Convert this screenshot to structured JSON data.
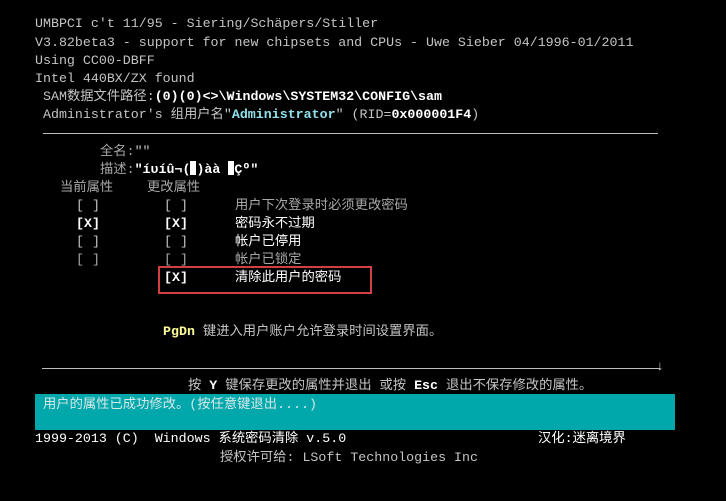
{
  "header_lines": [
    "UMBPCI c't 11/95 - Siering/Schäpers/Stiller",
    "V3.82beta3 - support for new chipsets and CPUs - Uwe Sieber 04/1996-01/2011",
    "Using CC00-DBFF",
    "Intel 440BX/ZX found"
  ],
  "sam": {
    "label": "SAM数据文件路径:",
    "path": "(0)(0)<>\\Windows\\SYSTEM32\\CONFIG\\sam"
  },
  "user": {
    "prefix": "Administrator's 组用户名\"",
    "name": "Administrator",
    "suffix": "\" (RID=",
    "rid": "0x000001F4",
    "close": ")"
  },
  "fullname": {
    "label": "全名:",
    "value": "\"\""
  },
  "description": {
    "label": "描述:",
    "value_a": "\"íυíû¬(",
    "value_b": ")àà ",
    "value_c": "Çº\""
  },
  "columns": {
    "current": "当前属性",
    "change": "更改属性"
  },
  "attributes": [
    {
      "current": "[ ]",
      "change": "[ ]",
      "label": "用户下次登录时必须更改密码"
    },
    {
      "current": "[X]",
      "change": "[X]",
      "label": "密码永不过期"
    },
    {
      "current": "[ ]",
      "change": "[ ]",
      "label": "帐户已停用"
    },
    {
      "current": "[ ]",
      "change": "[ ]",
      "label": "帐户已锁定"
    },
    {
      "current": "",
      "change": "[X]",
      "label": "清除此用户的密码"
    }
  ],
  "pgdn": {
    "key": "PgDn",
    "text": " 键进入用户账户允许登录时间设置界面。"
  },
  "scroll_arrow": "↓",
  "save_hint": {
    "a": "按 ",
    "key_y": "Y",
    "b": " 键保存更改的属性并退出 或按 ",
    "key_esc": "Esc",
    "c": " 退出不保存修改的属性。"
  },
  "status": "用户的属性已成功修改。(按任意键退出....)",
  "footer": {
    "copyright": "1999-2013 (C)  Windows 系统密码清除 v.5.0",
    "localized": "汉化:迷离境界",
    "license": "授权许可给: LSoft Technologies Inc"
  },
  "colors": {
    "status_bar": "#00a7ab",
    "highlight_box": "#d04040",
    "key": "#ffff9a",
    "username": "#8fe0ea"
  }
}
